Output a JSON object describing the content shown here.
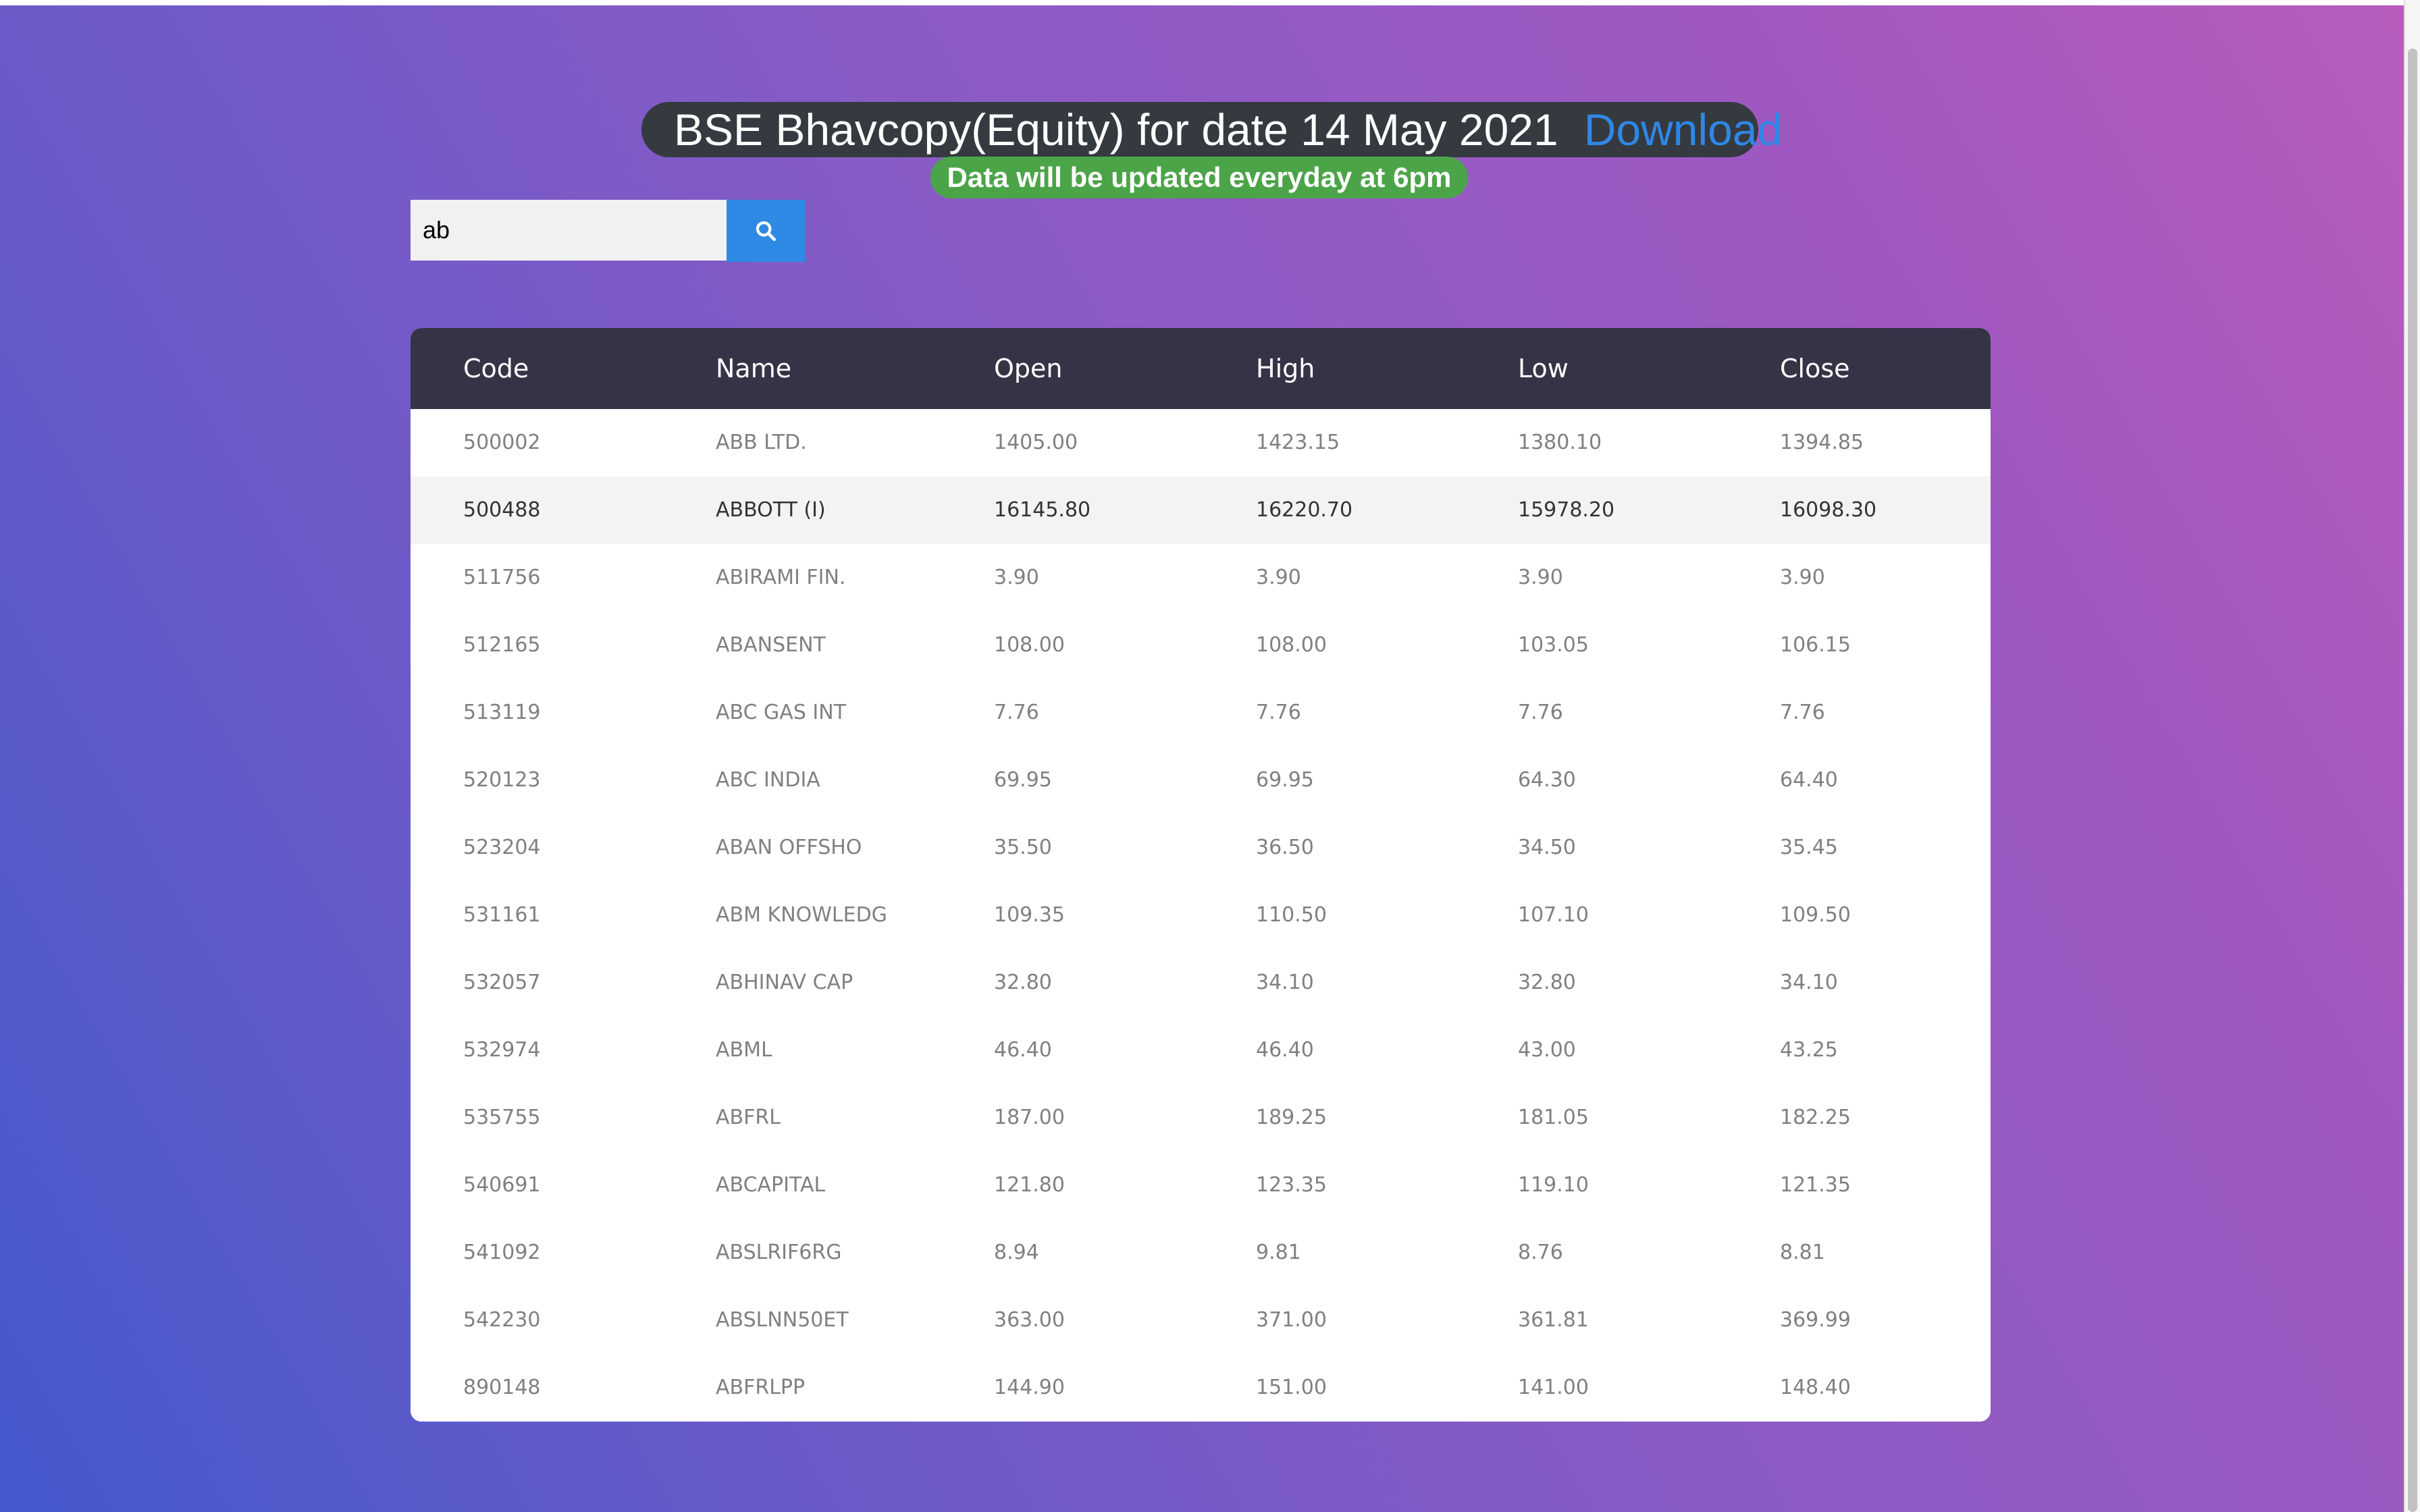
{
  "header": {
    "title": "BSE Bhavcopy(Equity) for date 14 May 2021",
    "download_label": "Download",
    "notice": "Data will be updated everyday at 6pm"
  },
  "search": {
    "value": "ab",
    "icon": "search-icon",
    "button_color": "#2f8ae6"
  },
  "table": {
    "columns": [
      "Code",
      "Name",
      "Open",
      "High",
      "Low",
      "Close"
    ],
    "rows": [
      [
        "500002",
        "ABB LTD.",
        "1405.00",
        "1423.15",
        "1380.10",
        "1394.85"
      ],
      [
        "500488",
        "ABBOTT (I)",
        "16145.80",
        "16220.70",
        "15978.20",
        "16098.30"
      ],
      [
        "511756",
        "ABIRAMI FIN.",
        "3.90",
        "3.90",
        "3.90",
        "3.90"
      ],
      [
        "512165",
        "ABANSENT",
        "108.00",
        "108.00",
        "103.05",
        "106.15"
      ],
      [
        "513119",
        "ABC GAS INT",
        "7.76",
        "7.76",
        "7.76",
        "7.76"
      ],
      [
        "520123",
        "ABC INDIA",
        "69.95",
        "69.95",
        "64.30",
        "64.40"
      ],
      [
        "523204",
        "ABAN OFFSHO",
        "35.50",
        "36.50",
        "34.50",
        "35.45"
      ],
      [
        "531161",
        "ABM KNOWLEDG",
        "109.35",
        "110.50",
        "107.10",
        "109.50"
      ],
      [
        "532057",
        "ABHINAV CAP",
        "32.80",
        "34.10",
        "32.80",
        "34.10"
      ],
      [
        "532974",
        "ABML",
        "46.40",
        "46.40",
        "43.00",
        "43.25"
      ],
      [
        "535755",
        "ABFRL",
        "187.00",
        "189.25",
        "181.05",
        "182.25"
      ],
      [
        "540691",
        "ABCAPITAL",
        "121.80",
        "123.35",
        "119.10",
        "121.35"
      ],
      [
        "541092",
        "ABSLRIF6RG",
        "8.94",
        "9.81",
        "8.76",
        "8.81"
      ],
      [
        "542230",
        "ABSLNN50ET",
        "363.00",
        "371.00",
        "361.81",
        "369.99"
      ],
      [
        "890148",
        "ABFRLPP",
        "144.90",
        "151.00",
        "141.00",
        "148.40"
      ]
    ],
    "highlighted_row_index": 1
  },
  "colors": {
    "title_pill": "#343a40",
    "download_link": "#2f87e6",
    "notice_pill": "#4ca449",
    "table_header": "#343446"
  }
}
